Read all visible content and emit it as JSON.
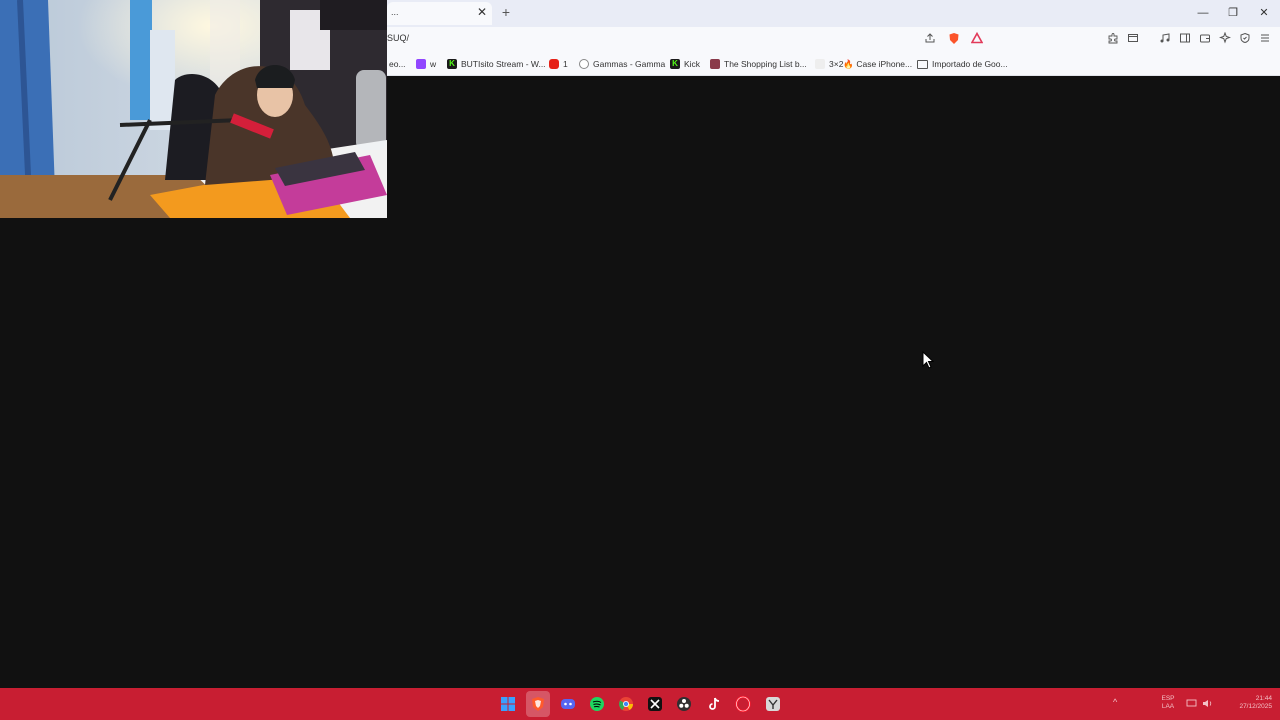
{
  "browser": {
    "tab": {
      "title": "...",
      "close": "✕"
    },
    "new_tab": "+",
    "window_controls": {
      "minimize": "—",
      "restore": "❐",
      "close": "✕"
    },
    "url": "SUQ/",
    "bookmarks": [
      {
        "label": "eo...",
        "icon": "generic-favicon"
      },
      {
        "label": "w",
        "icon": "twitch-favicon"
      },
      {
        "label": "BUTIsito Stream - W...",
        "icon": "kick-favicon"
      },
      {
        "label": "1",
        "icon": "youtube-favicon"
      },
      {
        "label": "Gammas - Gamma",
        "icon": "g-favicon"
      },
      {
        "label": "Kick",
        "icon": "kick-favicon"
      },
      {
        "label": "The Shopping List b...",
        "icon": "shopping-favicon"
      },
      {
        "label": "3×2🔥 Case iPhone...",
        "icon": "generic-favicon"
      },
      {
        "label": "Importado de Goo...",
        "icon": "folder-icon"
      }
    ]
  },
  "taskbar": {
    "icons": [
      "windows-start",
      "brave",
      "discord",
      "spotify",
      "chrome",
      "capcut",
      "obs",
      "tiktok",
      "opera",
      "app"
    ],
    "tray": {
      "language_top": "ESP",
      "language_bottom": "LAA",
      "time": "21:44",
      "date": "27/12/2025"
    }
  },
  "colors": {
    "taskbar": "#c81e32",
    "page_background": "#111111",
    "chrome": "#f8f9fc"
  }
}
